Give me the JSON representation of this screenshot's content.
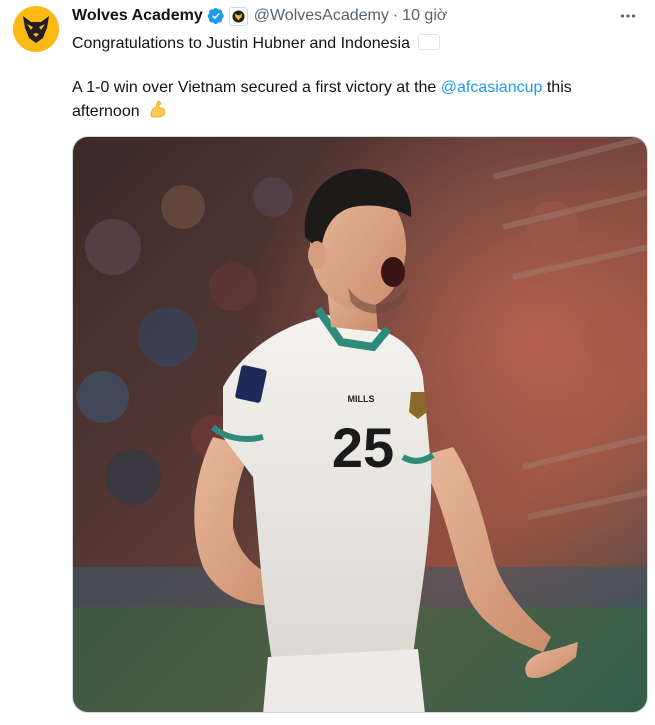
{
  "tweet": {
    "author": {
      "name": "Wolves Academy",
      "handle": "@WolvesAcademy",
      "avatar_icon": "wolf-head-icon",
      "avatar_color": "#fdb913",
      "verified_color": "#1d9bf0"
    },
    "separator": "·",
    "time": "10 giờ",
    "more_icon": "more-horizontal-icon",
    "line1": "Congratulations to Justin Hubner and Indonesia",
    "flag_icon": "indonesia-flag-icon",
    "line2_start": "A 1-0 win over Vietnam secured a first victory at the ",
    "mention": "@afcasiancup",
    "line2_end": " this afternoon",
    "emoji_icon": "flexed-biceps-icon",
    "mention_color": "#1d9bf0"
  },
  "photo": {
    "jersey_number": "25",
    "brand": "MILLS"
  }
}
